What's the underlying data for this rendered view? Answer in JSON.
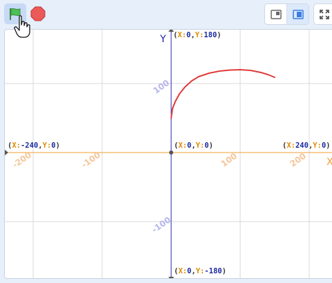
{
  "toolbar": {
    "green_flag": "green-flag-icon",
    "stop": "stop-sign-icon",
    "small_stage": "small-stage-icon",
    "normal_stage": "normal-stage-icon",
    "fullscreen": "fullscreen-icon"
  },
  "colors": {
    "x_axis": "#f0a030",
    "y_axis": "#2222aa",
    "grid": "#d8d8d8",
    "x_tick": "#f5c69a",
    "y_tick": "#b6b6ee",
    "pen": "#e03a3a",
    "flag_green": "#4cbf56",
    "stop_red": "#ec5959"
  },
  "chart_data": {
    "type": "line",
    "title": "",
    "xlabel": "X",
    "ylabel": "Y",
    "xlim": [
      -240,
      240
    ],
    "ylim": [
      -180,
      180
    ],
    "grid": true,
    "x_ticks": [
      -200,
      -100,
      100,
      200
    ],
    "y_ticks": [
      100,
      -100
    ],
    "series": [
      {
        "x": [
          0,
          2,
          6,
          12,
          20,
          30,
          40,
          55,
          70,
          85,
          100,
          115,
          130,
          140,
          150
        ],
        "y": [
          50,
          64,
          74,
          85,
          95,
          104,
          110,
          115,
          118,
          119.5,
          120,
          119,
          116,
          113,
          109
        ]
      }
    ],
    "corner_labels": {
      "top": {
        "x_key": "X",
        "x_val": "0",
        "y_key": "Y",
        "y_val": "180"
      },
      "bottom": {
        "x_key": "X",
        "x_val": "0",
        "y_key": "Y",
        "y_val": "-180"
      },
      "left": {
        "x_key": "X",
        "x_val": "-240",
        "y_key": "Y",
        "y_val": "0"
      },
      "right": {
        "x_key": "X",
        "x_val": "240",
        "y_key": "Y",
        "y_val": "0"
      },
      "origin": {
        "x_key": "X",
        "x_val": "0",
        "y_key": "Y",
        "y_val": "0"
      }
    }
  }
}
